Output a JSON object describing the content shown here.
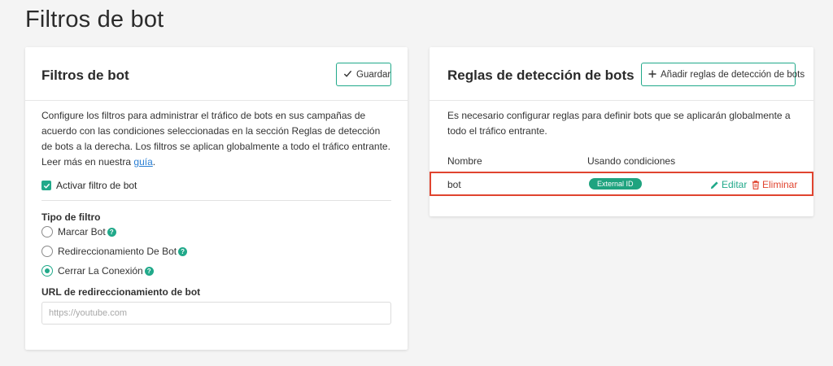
{
  "page": {
    "title": "Filtros de bot"
  },
  "left_card": {
    "title": "Filtros de bot",
    "save_label": "Guardar",
    "description": "Configure los filtros para administrar el tráfico de bots en sus campañas de acuerdo con las condiciones seleccionadas en la sección Reglas de detección de bots a la derecha. Los filtros se aplican globalmente a todo el tráfico entrante. Leer más en nuestra ",
    "guide_link": "guía",
    "guide_suffix": ".",
    "enable_label": "Activar filtro de bot",
    "enable_checked": true,
    "filter_type_label": "Tipo de filtro",
    "filter_types": [
      {
        "label": "Marcar Bot",
        "selected": false
      },
      {
        "label": "Redireccionamiento De Bot",
        "selected": false
      },
      {
        "label": "Cerrar La Conexión",
        "selected": true
      }
    ],
    "redirect_url_label": "URL de redireccionamiento de bot",
    "redirect_url_value": "",
    "redirect_url_placeholder": "https://youtube.com"
  },
  "right_card": {
    "title": "Reglas de detección de bots",
    "add_label": "Añadir reglas de detección de bots",
    "description": "Es necesario configurar reglas para definir bots que se aplicarán globalmente a todo el tráfico entrante.",
    "columns": [
      "Nombre",
      "Usando condiciones"
    ],
    "rows": [
      {
        "name": "bot",
        "condition": "External ID",
        "edit_label": "Editar",
        "delete_label": "Eliminar"
      }
    ]
  },
  "colors": {
    "accent": "#21a98a",
    "danger": "#e0442f",
    "link": "#2a7fd4"
  }
}
